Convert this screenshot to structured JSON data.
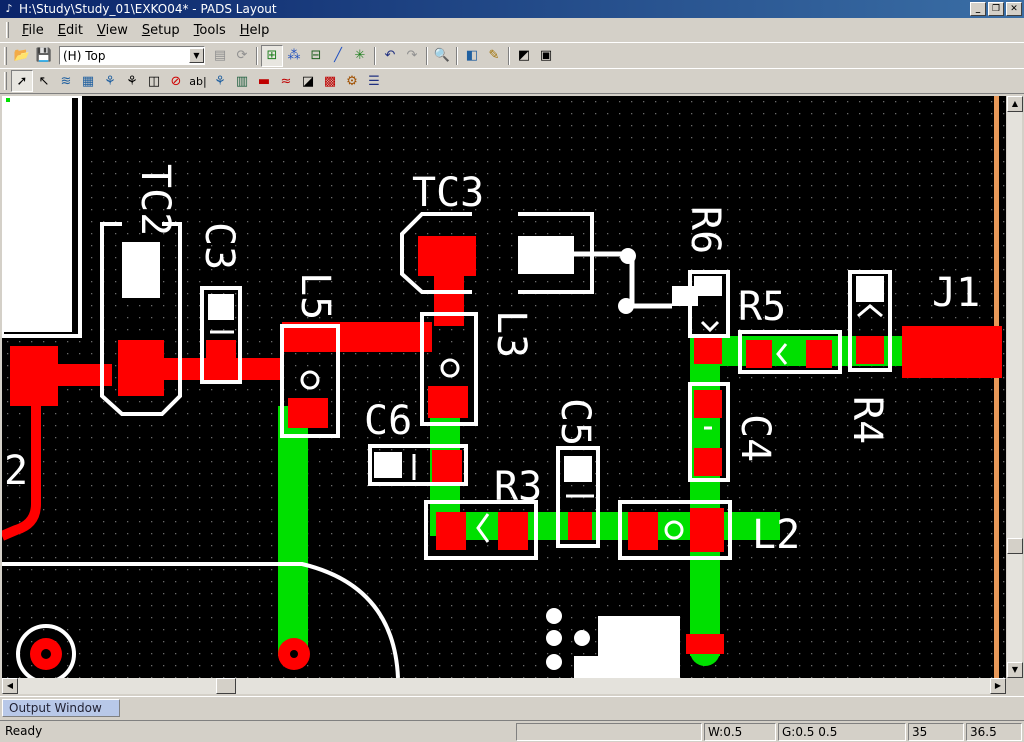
{
  "window": {
    "title": "H:\\Study\\Study_01\\EXKO04* - PADS Layout",
    "controls": [
      "minimize-icon",
      "restore-icon",
      "close-icon"
    ]
  },
  "menu": [
    {
      "label": "File",
      "u": "F",
      "rest": "ile"
    },
    {
      "label": "Edit",
      "u": "E",
      "rest": "dit"
    },
    {
      "label": "View",
      "u": "V",
      "rest": "iew"
    },
    {
      "label": "Setup",
      "u": "S",
      "rest": "etup"
    },
    {
      "label": "Tools",
      "u": "T",
      "rest": "ools"
    },
    {
      "label": "Help",
      "u": "H",
      "rest": "elp"
    }
  ],
  "toolbar1": {
    "layer_value": "(H) Top",
    "icons": [
      "open-icon",
      "save-icon",
      "properties-icon",
      "cycle-icon",
      "design-toolbar-icon",
      "drafting-toolbar-icon",
      "dimension-toolbar-icon",
      "route-toolbar-icon",
      "ecoe-icon",
      "undo-icon",
      "redo-icon",
      "zoom-icon",
      "layer-display-icon",
      "highlight-icon",
      "session-log-icon",
      "window-icon"
    ]
  },
  "toolbar2": {
    "icons": [
      "select-icon",
      "move-icon",
      "copper-icon",
      "copper-cutout-icon",
      "copper-pour-icon",
      "hatch-outline-icon",
      "board-outline-icon",
      "keepout-icon",
      "text-icon",
      "2d-line-icon",
      "from-library-icon",
      "drafting-properties-icon",
      "associated-copper-icon",
      "merge-icon",
      "via-icon",
      "component-icon",
      "table-icon"
    ]
  },
  "pcb": {
    "ref_labels": [
      "TC2",
      "TC3",
      "C3",
      "L5",
      "L3",
      "R6",
      "R5",
      "J1",
      "C6",
      "C5",
      "R3",
      "C4",
      "R4",
      "L2",
      "2"
    ],
    "colors": {
      "background": "#000000",
      "top_copper": "#ff0000",
      "bottom_trace": "#00e000",
      "silkscreen": "#ffffff",
      "grid": "#606060",
      "board_edge": "#f0a060"
    }
  },
  "output_window": {
    "tab_label": "Output Window"
  },
  "status": {
    "message": "Ready",
    "width": "W:0.5",
    "grid": "G:0.5 0.5",
    "x": "35",
    "y": "36.5"
  }
}
